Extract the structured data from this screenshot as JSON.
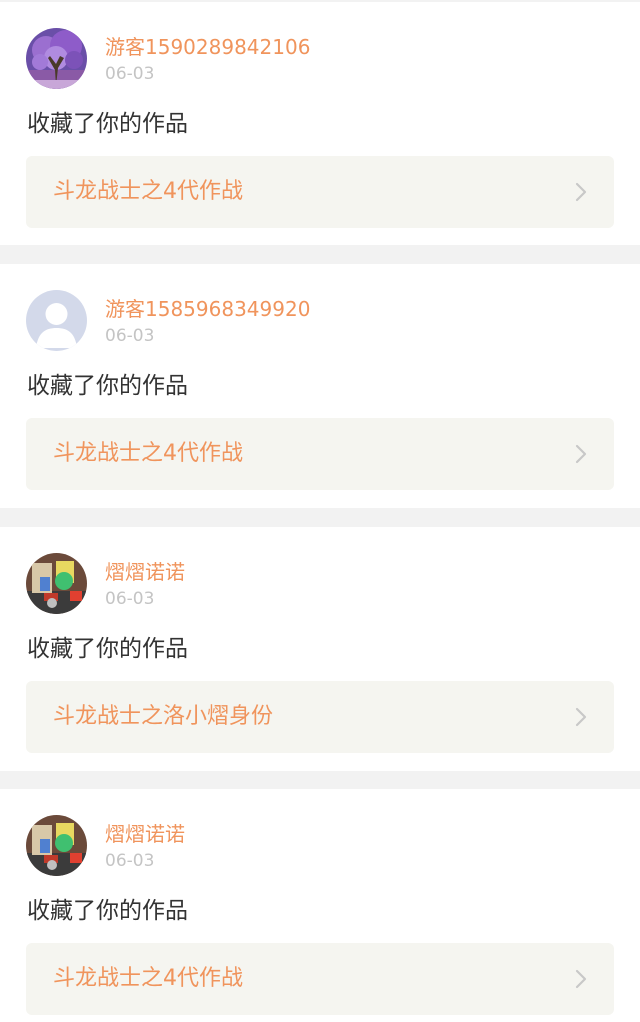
{
  "notifications": [
    {
      "username": "游客1590289842106",
      "date": "06-03",
      "action": "收藏了你的作品",
      "work_title": "斗龙战士之4代作战",
      "avatar": "purple-tree-photo-avatar"
    },
    {
      "username": "游客1585968349920",
      "date": "06-03",
      "action": "收藏了你的作品",
      "work_title": "斗龙战士之4代作战",
      "avatar": "default-person-avatar"
    },
    {
      "username": "熠熠诺诺",
      "date": "06-03",
      "action": "收藏了你的作品",
      "work_title": "斗龙战士之洛小熠身份",
      "avatar": "toy-robot-photo-avatar"
    },
    {
      "username": "熠熠诺诺",
      "date": "06-03",
      "action": "收藏了你的作品",
      "work_title": "斗龙战士之4代作战",
      "avatar": "toy-robot-photo-avatar"
    }
  ],
  "colors": {
    "accent": "#f0945c",
    "date": "#c4c4c4",
    "text": "#333333",
    "link_bg": "#f5f5f0",
    "page_bg": "#f2f2f2",
    "chevron": "#c8c8c8"
  }
}
